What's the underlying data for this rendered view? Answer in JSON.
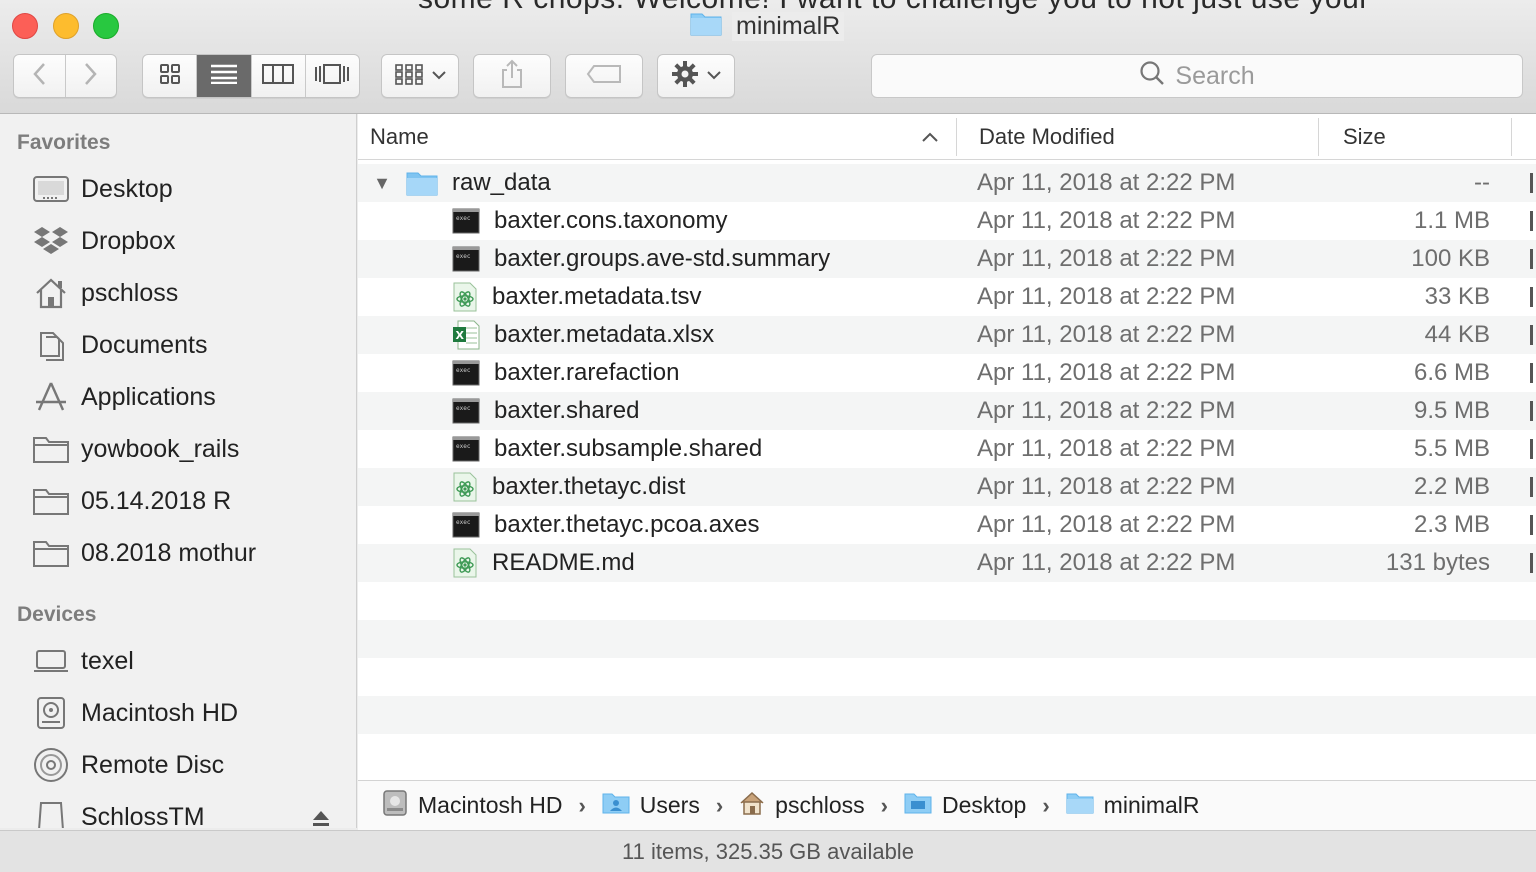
{
  "window": {
    "title": "minimalR",
    "background_text": "some R chops. Welcome! I want to challenge you to not just use your"
  },
  "toolbar": {
    "back_icon": "chevron-left-icon",
    "forward_icon": "chevron-right-icon",
    "view_modes": [
      "icon-view-icon",
      "list-view-icon",
      "column-view-icon",
      "cover-flow-icon"
    ],
    "active_view": "list",
    "search_placeholder": "Search"
  },
  "sidebar": {
    "sections": [
      {
        "header": "Favorites",
        "items": [
          {
            "label": "Desktop",
            "icon": "desktop-icon"
          },
          {
            "label": "Dropbox",
            "icon": "dropbox-icon"
          },
          {
            "label": "pschloss",
            "icon": "home-icon"
          },
          {
            "label": "Documents",
            "icon": "documents-icon"
          },
          {
            "label": "Applications",
            "icon": "applications-icon"
          },
          {
            "label": "yowbook_rails",
            "icon": "folder-icon"
          },
          {
            "label": "05.14.2018 R",
            "icon": "folder-icon"
          },
          {
            "label": "08.2018 mothur",
            "icon": "folder-icon"
          }
        ]
      },
      {
        "header": "Devices",
        "items": [
          {
            "label": "texel",
            "icon": "laptop-icon"
          },
          {
            "label": "Macintosh HD",
            "icon": "hard-drive-icon"
          },
          {
            "label": "Remote Disc",
            "icon": "disc-icon"
          },
          {
            "label": "SchlossTM",
            "icon": "external-drive-icon"
          }
        ]
      }
    ]
  },
  "list": {
    "columns": {
      "name": "Name",
      "date": "Date Modified",
      "size": "Size"
    },
    "rows": [
      {
        "name": "raw_data",
        "date": "Apr 11, 2018 at 2:22 PM",
        "size": "--",
        "type": "folder",
        "level": 0
      },
      {
        "name": "baxter.cons.taxonomy",
        "date": "Apr 11, 2018 at 2:22 PM",
        "size": "1.1 MB",
        "type": "terminal",
        "level": 1
      },
      {
        "name": "baxter.groups.ave-std.summary",
        "date": "Apr 11, 2018 at 2:22 PM",
        "size": "100 KB",
        "type": "terminal",
        "level": 1
      },
      {
        "name": "baxter.metadata.tsv",
        "date": "Apr 11, 2018 at 2:22 PM",
        "size": "33 KB",
        "type": "atom",
        "level": 1
      },
      {
        "name": "baxter.metadata.xlsx",
        "date": "Apr 11, 2018 at 2:22 PM",
        "size": "44 KB",
        "type": "excel",
        "level": 1
      },
      {
        "name": "baxter.rarefaction",
        "date": "Apr 11, 2018 at 2:22 PM",
        "size": "6.6 MB",
        "type": "terminal",
        "level": 1
      },
      {
        "name": "baxter.shared",
        "date": "Apr 11, 2018 at 2:22 PM",
        "size": "9.5 MB",
        "type": "terminal",
        "level": 1
      },
      {
        "name": "baxter.subsample.shared",
        "date": "Apr 11, 2018 at 2:22 PM",
        "size": "5.5 MB",
        "type": "terminal",
        "level": 1
      },
      {
        "name": "baxter.thetayc.dist",
        "date": "Apr 11, 2018 at 2:22 PM",
        "size": "2.2 MB",
        "type": "atom",
        "level": 1
      },
      {
        "name": "baxter.thetayc.pcoa.axes",
        "date": "Apr 11, 2018 at 2:22 PM",
        "size": "2.3 MB",
        "type": "terminal",
        "level": 1
      },
      {
        "name": "README.md",
        "date": "Apr 11, 2018 at 2:22 PM",
        "size": "131 bytes",
        "type": "atom",
        "level": 1
      }
    ]
  },
  "path": [
    {
      "label": "Macintosh HD",
      "icon": "hard-drive-icon"
    },
    {
      "label": "Users",
      "icon": "folder-icon"
    },
    {
      "label": "pschloss",
      "icon": "home-icon"
    },
    {
      "label": "Desktop",
      "icon": "folder-icon"
    },
    {
      "label": "minimalR",
      "icon": "folder-icon"
    }
  ],
  "status": "11 items, 325.35 GB available"
}
